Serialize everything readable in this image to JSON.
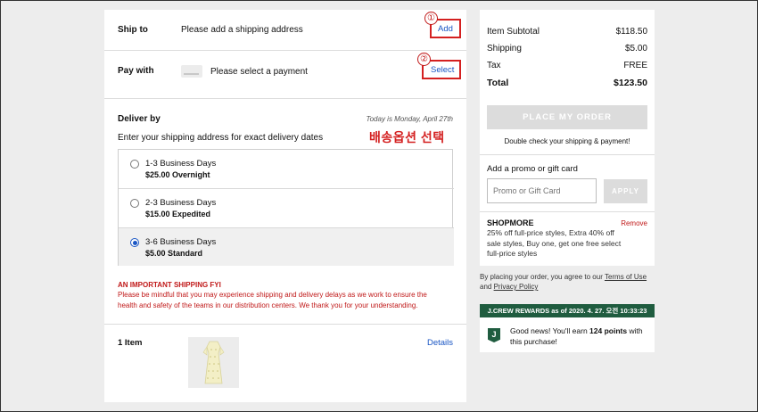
{
  "shipping": {
    "label": "Ship to",
    "placeholder": "Please add a shipping address",
    "action": "Add",
    "marker": "①"
  },
  "payment": {
    "label": "Pay with",
    "placeholder": "Please select a payment",
    "action": "Select",
    "marker": "②"
  },
  "delivery": {
    "title": "Deliver by",
    "today": "Today is Monday, April 27th",
    "instructions": "Enter your shipping address for exact delivery dates",
    "annotation": "배송옵션 선택",
    "options": [
      {
        "name": "1-3 Business Days",
        "price": "$25.00 Overnight",
        "selected": false
      },
      {
        "name": "2-3 Business Days",
        "price": "$15.00 Expedited",
        "selected": false
      },
      {
        "name": "3-6 Business Days",
        "price": "$5.00 Standard",
        "selected": true
      }
    ]
  },
  "notice": {
    "title": "AN IMPORTANT SHIPPING FYI",
    "body": "Please be mindful that you may experience shipping and delivery delays as we work to ensure the health and safety of the teams in our distribution centers. We thank you for your understanding."
  },
  "items": {
    "count_label": "1 Item",
    "details_link": "Details"
  },
  "summary": {
    "subtotal_label": "Item Subtotal",
    "subtotal_value": "$118.50",
    "shipping_label": "Shipping",
    "shipping_value": "$5.00",
    "tax_label": "Tax",
    "tax_value": "FREE",
    "total_label": "Total",
    "total_value": "$123.50",
    "place_order": "PLACE MY ORDER",
    "hint": "Double check your shipping & payment!"
  },
  "promo": {
    "title": "Add a promo or gift card",
    "placeholder": "Promo or Gift Card",
    "apply": "APPLY",
    "code": "SHOPMORE",
    "remove": "Remove",
    "description": "25% off full-price styles, Extra 40% off sale styles, Buy one, get one free select full-price styles"
  },
  "terms": {
    "prefix": "By placing your order, you agree to our ",
    "terms_link": "Terms of Use",
    "and": " and ",
    "privacy_link": "Privacy Policy"
  },
  "rewards": {
    "banner": "J.CREW REWARDS as of 2020. 4. 27. 오전 10:33:23",
    "logo": "J",
    "message_prefix": "Good news! You'll earn ",
    "points": "124 points",
    "message_suffix": " with this purchase!"
  },
  "colors": {
    "link": "#1a56c4",
    "alert": "#c01818",
    "rewards_green": "#1f5c3f"
  }
}
